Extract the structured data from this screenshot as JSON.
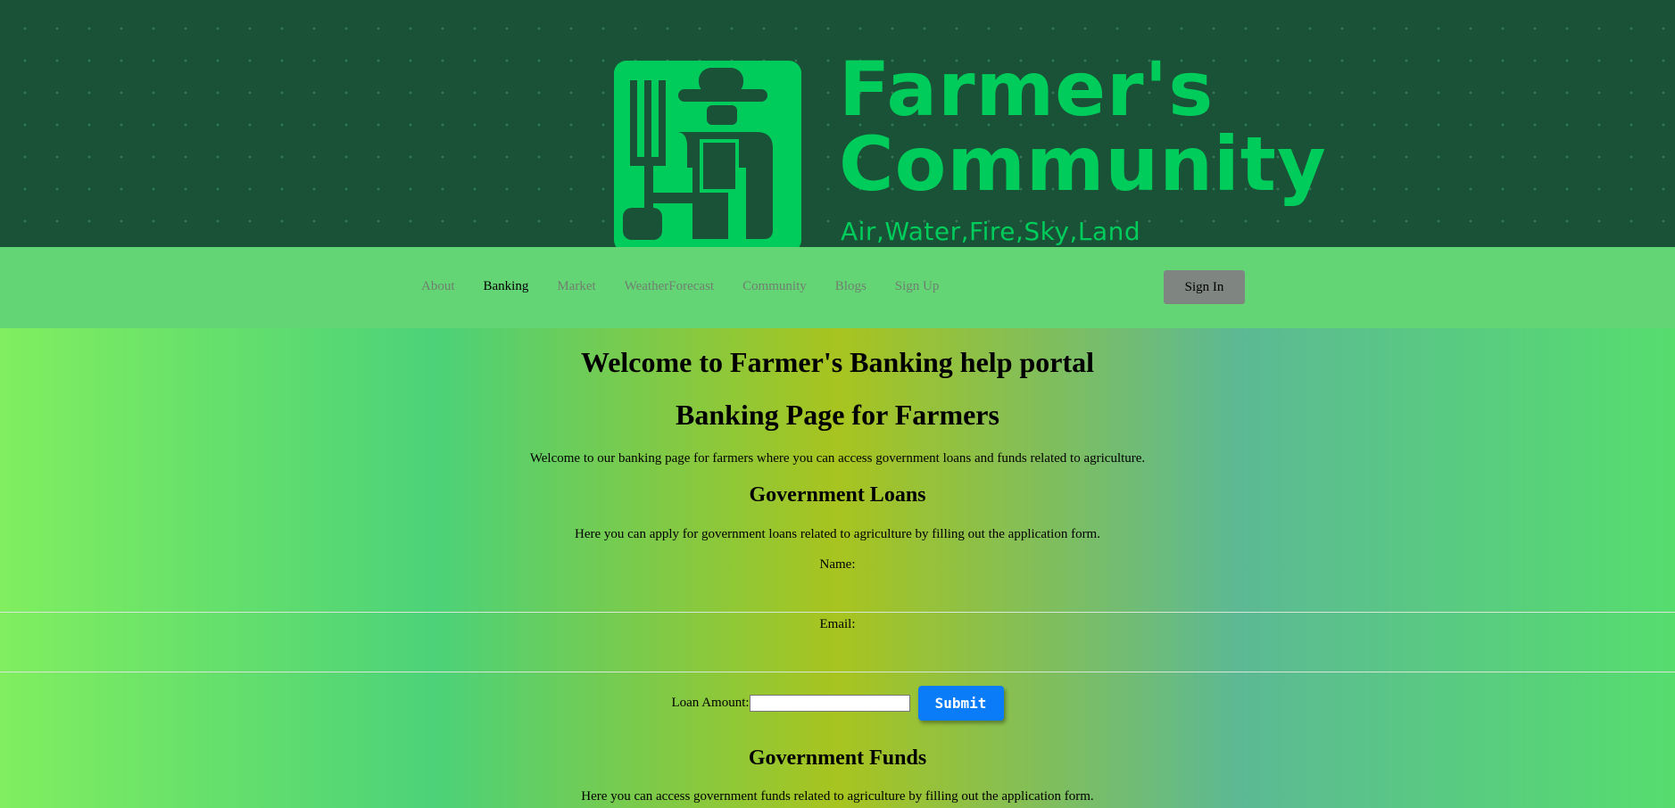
{
  "banner": {
    "brand_line1": "Farmer's",
    "brand_line2": "Community",
    "tagline": "Air,Water,Fire,Sky,Land",
    "brand_color": "#00cc5c",
    "background_color": "#195236"
  },
  "nav": {
    "items": [
      {
        "label": "About",
        "active": false
      },
      {
        "label": "Banking",
        "active": true
      },
      {
        "label": "Market",
        "active": false
      },
      {
        "label": "WeatherForecast",
        "active": false
      },
      {
        "label": "Community",
        "active": false
      },
      {
        "label": "Blogs",
        "active": false
      },
      {
        "label": "Sign Up",
        "active": false
      }
    ],
    "signin_label": "Sign In"
  },
  "main": {
    "welcome_heading": "Welcome to Farmer's Banking help portal",
    "page_heading": "Banking Page for Farmers",
    "intro": "Welcome to our banking page for farmers where you can access government loans and funds related to agriculture.",
    "loans": {
      "heading": "Government Loans",
      "description": "Here you can apply for government loans related to agriculture by filling out the application form.",
      "name_label": "Name:",
      "email_label": "Email:",
      "loan_amount_label": "Loan Amount:",
      "loan_amount_value": "",
      "submit_label": "Submit"
    },
    "funds": {
      "heading": "Government Funds",
      "description": "Here you can access government funds related to agriculture by filling out the application form."
    }
  },
  "colors": {
    "nav_bg": "#64d574",
    "signin_bg": "#7f8580",
    "submit_bg": "#0a7cf8"
  }
}
